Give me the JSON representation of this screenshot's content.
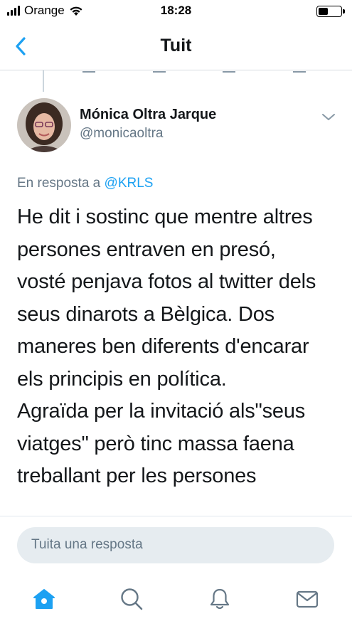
{
  "status_bar": {
    "carrier": "Orange",
    "time": "18:28",
    "battery_level": 0.45,
    "icons": [
      "signal-icon",
      "wifi-icon",
      "battery-icon"
    ]
  },
  "nav": {
    "title": "Tuit",
    "back_icon": "chevron-left-icon"
  },
  "tweet": {
    "author_name": "Mónica Oltra Jarque",
    "author_handle": "@monicaoltra",
    "reply_prefix": "En resposta a",
    "reply_mention": "@KRLS",
    "text": "He dit i sostinc que mentre altres\npersones entraven en presó,\nvosté penjava fotos al twitter dels\nseus dinarots a Bèlgica. Dos\nmaneres ben diferents d'encarar\nels principis en política.\nAgraïda per la invitació als\"seus\nviatges\" però tinc massa faena\ntreballant per les persones"
  },
  "reply_box": {
    "placeholder": "Tuita una resposta"
  },
  "tab_bar": {
    "tabs": [
      {
        "icon": "home-icon",
        "active": true
      },
      {
        "icon": "search-icon",
        "active": false
      },
      {
        "icon": "notifications-icon",
        "active": false
      },
      {
        "icon": "messages-icon",
        "active": false
      }
    ]
  },
  "colors": {
    "accent": "#1da1f2",
    "secondary_text": "#657786",
    "primary_text": "#14171a",
    "reply_box_bg": "#e6ecf0"
  }
}
